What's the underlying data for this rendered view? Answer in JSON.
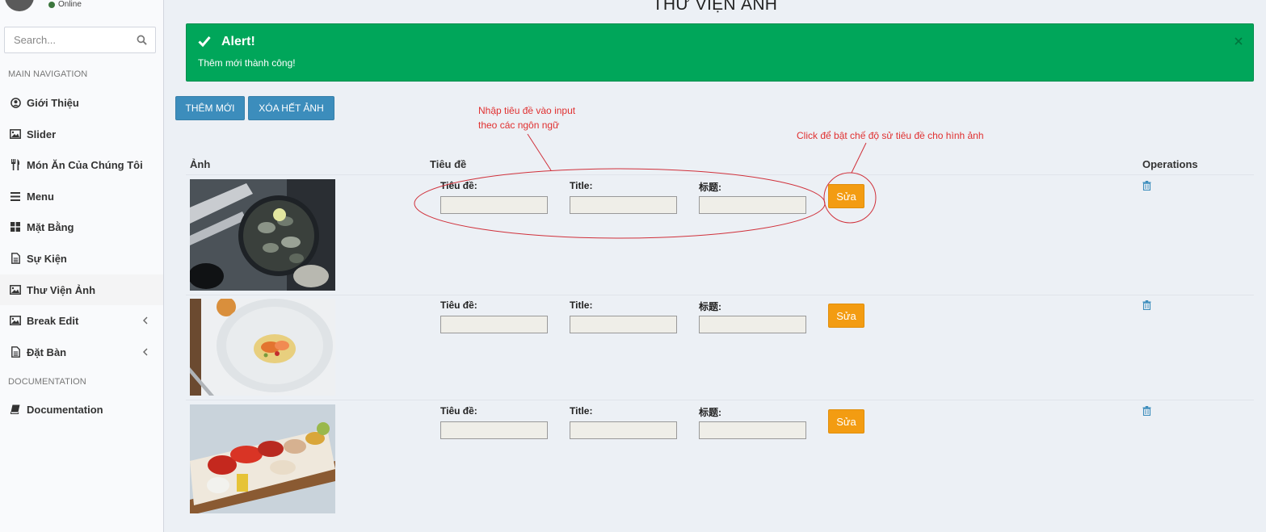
{
  "user": {
    "status": "Online"
  },
  "search": {
    "placeholder": "Search..."
  },
  "nav": {
    "main_header": "MAIN NAVIGATION",
    "items": [
      {
        "label": "Giới Thiệu",
        "icon": "user-circle-icon"
      },
      {
        "label": "Slider",
        "icon": "image-icon"
      },
      {
        "label": "Món Ăn Của Chúng Tôi",
        "icon": "cutlery-icon"
      },
      {
        "label": "Menu",
        "icon": "bars-icon"
      },
      {
        "label": "Mặt Bằng",
        "icon": "th-large-icon"
      },
      {
        "label": "Sự Kiện",
        "icon": "file-icon"
      },
      {
        "label": "Thư Viện Ảnh",
        "icon": "image-icon",
        "active": true
      },
      {
        "label": "Break Edit",
        "icon": "image-icon",
        "has_submenu": true
      },
      {
        "label": "Đặt Bàn",
        "icon": "file-icon",
        "has_submenu": true
      }
    ],
    "doc_header": "DOCUMENTATION",
    "doc_item": {
      "label": "Documentation",
      "icon": "book-icon"
    }
  },
  "page": {
    "title": "THƯ VIỆN ẢNH"
  },
  "alert": {
    "title": "Alert!",
    "message": "Thêm mới thành công!",
    "close": "×",
    "color": "#00a65a"
  },
  "toolbar": {
    "add_label": "THÊM MỚI",
    "delete_all_label": "XÓA HẾT ẢNH",
    "color": "#3c8dbc"
  },
  "annotations": {
    "input_note_line1": "Nhập tiêu đề vào input",
    "input_note_line2": "theo các ngôn ngữ",
    "edit_note": "Click để bật chế độ sử tiêu đề cho hình ảnh",
    "color": "#e03030"
  },
  "table": {
    "headers": {
      "image": "Ảnh",
      "title": "Tiêu đề",
      "operations": "Operations"
    },
    "field_labels": {
      "vi": "Tiêu đề:",
      "en": "Title:",
      "zh": "标题:"
    },
    "rows": [
      {
        "image": "clams-in-pan",
        "title_vi": "",
        "title_en": "",
        "title_zh": "",
        "edit_label": "Sửa"
      },
      {
        "image": "shrimp-plate",
        "title_vi": "",
        "title_en": "",
        "title_zh": "",
        "edit_label": "Sửa"
      },
      {
        "image": "seafood-platter",
        "title_vi": "",
        "title_en": "",
        "title_zh": "",
        "edit_label": "Sửa"
      }
    ],
    "edit_color": "#f39c12"
  }
}
